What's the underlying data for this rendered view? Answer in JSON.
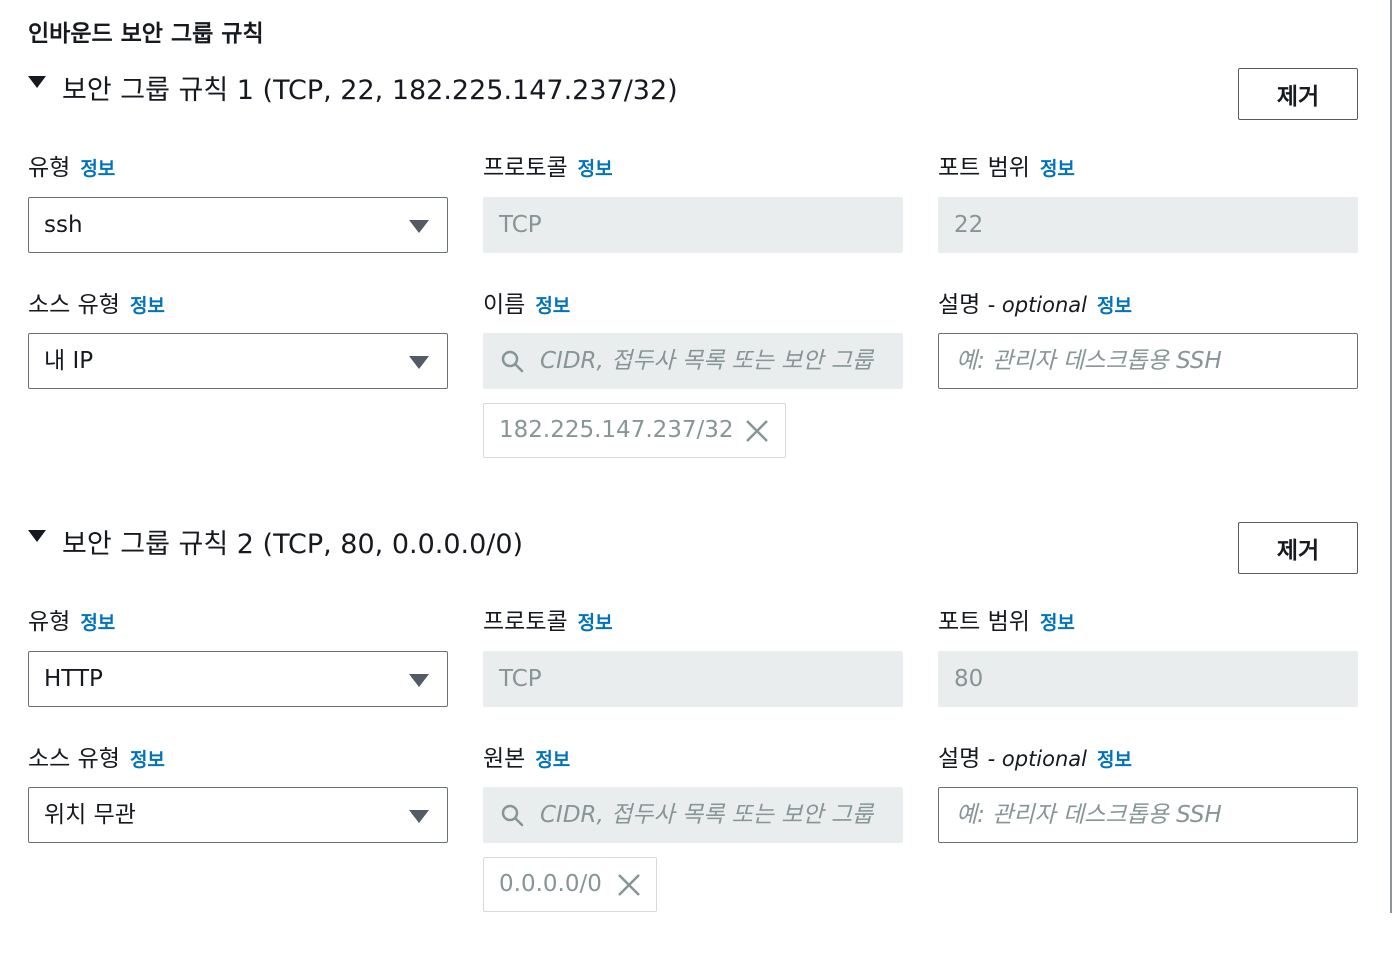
{
  "section_title": "인바운드 보안 그룹 규칙",
  "labels": {
    "type": "유형",
    "protocol": "프로토콜",
    "port_range": "포트 범위",
    "source_type": "소스 유형",
    "description": "설명",
    "optional": "- optional",
    "info": "정보"
  },
  "colors": {
    "link": "#0073bb",
    "border": "#687078",
    "disabled_bg": "#eaeded",
    "muted_text": "#879596"
  },
  "rules": [
    {
      "title": "보안 그룹 규칙 1 (TCP, 22, 182.225.147.237/32)",
      "remove_label": "제거",
      "type_value": "ssh",
      "protocol_value": "TCP",
      "port_value": "22",
      "source_type_value": "내 IP",
      "source_label": "이름",
      "source_placeholder": "CIDR, 접두사 목록 또는 보안 그룹",
      "description_placeholder": "예: 관리자 데스크톱용 SSH",
      "token_value": "182.225.147.237/32"
    },
    {
      "title": "보안 그룹 규칙 2 (TCP, 80, 0.0.0.0/0)",
      "remove_label": "제거",
      "type_value": "HTTP",
      "protocol_value": "TCP",
      "port_value": "80",
      "source_type_value": "위치 무관",
      "source_label": "원본",
      "source_placeholder": "CIDR, 접두사 목록 또는 보안 그룹",
      "description_placeholder": "예: 관리자 데스크톱용 SSH",
      "token_value": "0.0.0.0/0"
    }
  ]
}
